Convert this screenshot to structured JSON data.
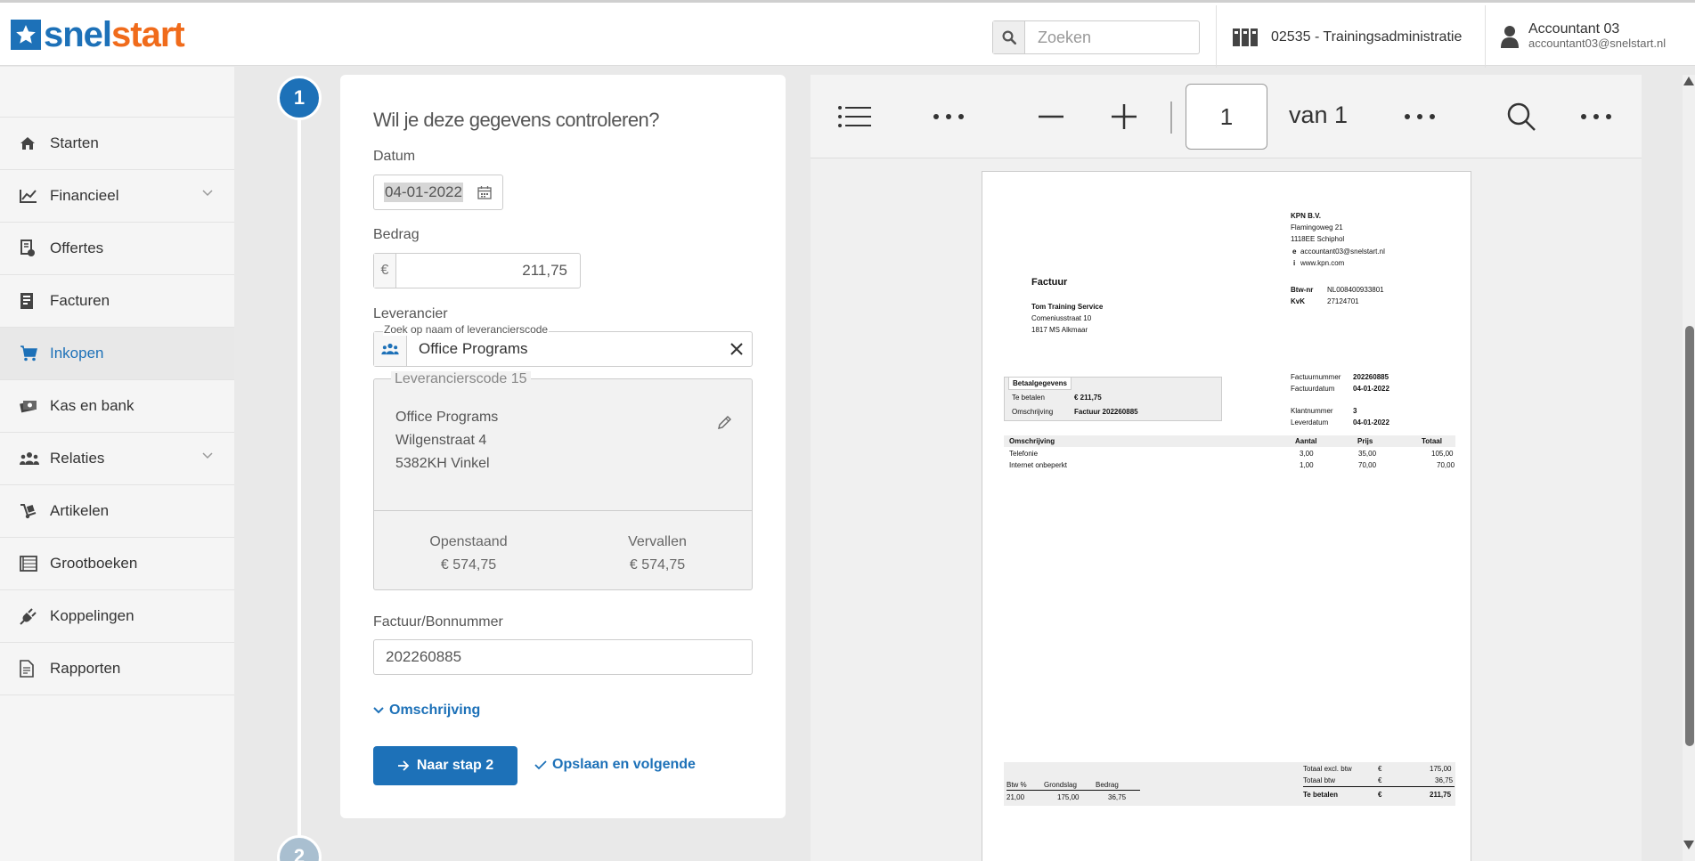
{
  "header": {
    "logo_part1": "snel",
    "logo_part2": "start",
    "search_placeholder": "Zoeken",
    "administration": "02535 - Trainingsadministratie",
    "user_name": "Accountant 03",
    "user_email": "accountant03@snelstart.nl"
  },
  "sidebar": {
    "items": [
      {
        "label": "Starten",
        "icon": "home-icon"
      },
      {
        "label": "Financieel",
        "icon": "chart-line-icon"
      },
      {
        "label": "Offertes",
        "icon": "offer-icon"
      },
      {
        "label": "Facturen",
        "icon": "invoice-icon"
      },
      {
        "label": "Inkopen",
        "icon": "cart-icon"
      },
      {
        "label": "Kas en bank",
        "icon": "cash-icon"
      },
      {
        "label": "Relaties",
        "icon": "users-icon"
      },
      {
        "label": "Artikelen",
        "icon": "dolly-icon"
      },
      {
        "label": "Grootboeken",
        "icon": "ledger-icon"
      },
      {
        "label": "Koppelingen",
        "icon": "plug-icon"
      },
      {
        "label": "Rapporten",
        "icon": "report-icon"
      }
    ]
  },
  "steps": {
    "current": "1",
    "next": "2"
  },
  "form": {
    "title": "Wil je deze gegevens controleren?",
    "datum_label": "Datum",
    "datum_value": "04-01-2022",
    "bedrag_label": "Bedrag",
    "currency_symbol": "€",
    "bedrag_value": "211,75",
    "leverancier_label": "Leverancier",
    "leverancier_floating": "Zoek op naam of leverancierscode",
    "leverancier_value": "Office Programs",
    "leverancier_code": "Leverancierscode 15",
    "address_line1": "Office Programs",
    "address_line2": "Wilgenstraat 4",
    "address_line3": "5382KH Vinkel",
    "openstaand_label": "Openstaand",
    "openstaand_value": "€ 574,75",
    "vervallen_label": "Vervallen",
    "vervallen_value": "€ 574,75",
    "factuur_label": "Factuur/Bonnummer",
    "factuur_value": "202260885",
    "omschrijving_link": "Omschrijving",
    "next_button": "Naar stap 2",
    "save_button": "Opslaan en volgende"
  },
  "viewer": {
    "page_number": "1",
    "page_total": "van 1"
  },
  "invoice": {
    "company": "KPN B.V.",
    "company_street": "Flamingoweg 21",
    "company_city": "1118EE Schiphol",
    "email_label": "e",
    "email": "accountant03@snelstart.nl",
    "web_label": "i",
    "web": "www.kpn.com",
    "btw_label": "Btw-nr",
    "btw_value": "NL008400933801",
    "kvk_label": "KvK",
    "kvk_value": "27124701",
    "title": "Factuur",
    "customer": "Tom Training Service",
    "customer_street": "Comeniusstraat 10",
    "customer_city": "1817 MS Alkmaar",
    "betaal_header": "Betaalgegevens",
    "te_betalen_label": "Te betalen",
    "te_betalen_value": "€ 211,75",
    "omschrijving_label": "Omschrijving",
    "omschrijving_value": "Factuur 202260885",
    "factuurnummer_label": "Factuurnummer",
    "factuurnummer_value": "202260885",
    "factuurdatum_label": "Factuurdatum",
    "factuurdatum_value": "04-01-2022",
    "klantnummer_label": "Klantnummer",
    "klantnummer_value": "3",
    "leverdatum_label": "Leverdatum",
    "leverdatum_value": "04-01-2022",
    "columns": [
      "Omschrijving",
      "Aantal",
      "Prijs",
      "Totaal"
    ],
    "lines": [
      {
        "desc": "Telefonie",
        "qty": "3,00",
        "price": "35,00",
        "total": "105,00"
      },
      {
        "desc": "Internet onbeperkt",
        "qty": "1,00",
        "price": "70,00",
        "total": "70,00"
      }
    ],
    "vat_columns": [
      "Btw %",
      "Grondslag",
      "Bedrag"
    ],
    "vat_row": [
      "21,00",
      "175,00",
      "36,75"
    ],
    "totals": [
      {
        "label": "Totaal excl. btw",
        "cur": "€",
        "value": "175,00"
      },
      {
        "label": "Totaal btw",
        "cur": "€",
        "value": "36,75"
      },
      {
        "label": "Te betalen",
        "cur": "€",
        "value": "211,75"
      }
    ]
  },
  "colors": {
    "brand_blue": "#1d71b8",
    "brand_orange": "#f06b1b"
  }
}
